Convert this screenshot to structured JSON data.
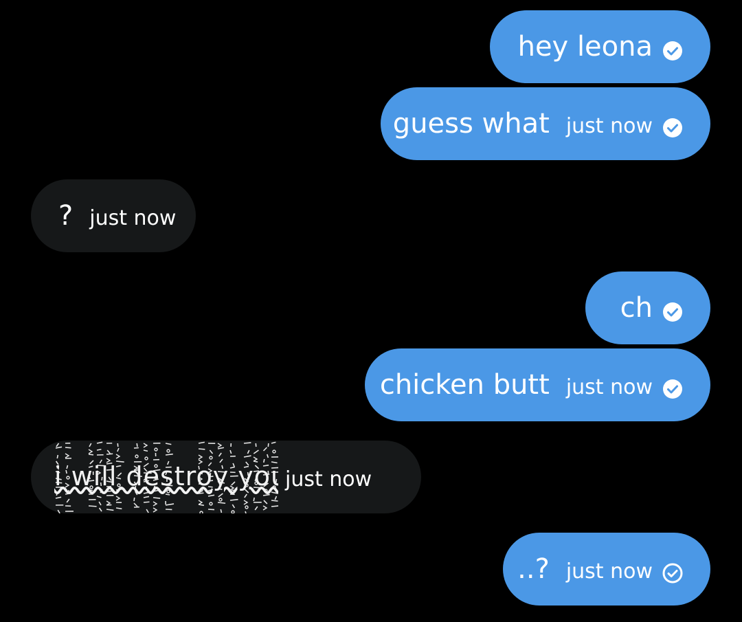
{
  "colors": {
    "sent_bubble": "#4b98e6",
    "received_bubble": "#161819",
    "background": "#000000"
  },
  "messages": [
    {
      "direction": "sent",
      "text": "hey leona",
      "time": "",
      "status_icon": "filled-check-circle-icon"
    },
    {
      "direction": "sent",
      "text": "guess what",
      "time": "just now",
      "status_icon": "filled-check-circle-icon"
    },
    {
      "direction": "received",
      "text": "?",
      "time": "just now"
    },
    {
      "direction": "sent",
      "text": "ch",
      "time": "",
      "status_icon": "filled-check-circle-icon"
    },
    {
      "direction": "sent",
      "text": "chicken butt",
      "time": "just now",
      "status_icon": "filled-check-circle-icon"
    },
    {
      "direction": "received",
      "text": "i will destroy you",
      "time": "just now",
      "effect": "glitch"
    },
    {
      "direction": "sent",
      "text": "..?",
      "time": "just now",
      "status_icon": "outline-check-circle-icon"
    }
  ]
}
